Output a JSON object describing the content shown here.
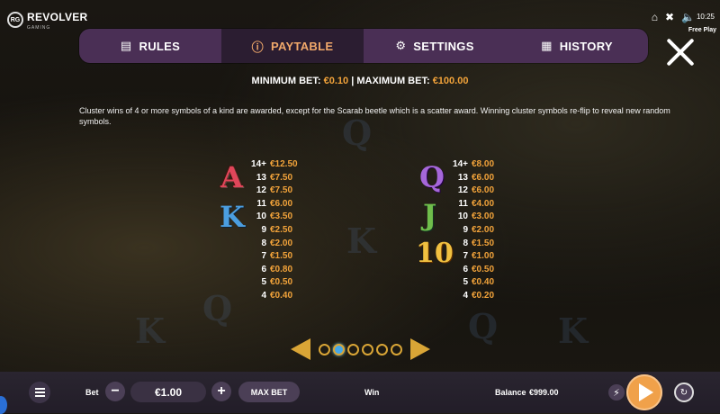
{
  "header": {
    "logo_badge": "RG",
    "logo_text": "REVOLVER",
    "logo_sub": "GAMING",
    "clock": "10:25",
    "free_play": "Free Play"
  },
  "tabs": [
    {
      "label": "RULES",
      "icon": "document-icon",
      "active": false
    },
    {
      "label": "PAYTABLE",
      "icon": "info-icon",
      "active": true
    },
    {
      "label": "SETTINGS",
      "icon": "gear-icon",
      "active": false
    },
    {
      "label": "HISTORY",
      "icon": "history-icon",
      "active": false
    }
  ],
  "bet_limits": {
    "min_label": "MINIMUM BET:",
    "min_value": "€0.10",
    "separator": "|",
    "max_label": "MAXIMUM BET:",
    "max_value": "€100.00"
  },
  "description": "Cluster wins of 4 or more symbols of a kind are awarded, except for the Scarab beetle which is a scatter award. Winning cluster symbols re-flip to reveal new random symbols.",
  "paytable": {
    "left": {
      "symbols": [
        "A",
        "K"
      ],
      "rows": [
        {
          "n": "14+",
          "v": "€12.50"
        },
        {
          "n": "13",
          "v": "€7.50"
        },
        {
          "n": "12",
          "v": "€7.50"
        },
        {
          "n": "11",
          "v": "€6.00"
        },
        {
          "n": "10",
          "v": "€3.50"
        },
        {
          "n": "9",
          "v": "€2.50"
        },
        {
          "n": "8",
          "v": "€2.00"
        },
        {
          "n": "7",
          "v": "€1.50"
        },
        {
          "n": "6",
          "v": "€0.80"
        },
        {
          "n": "5",
          "v": "€0.50"
        },
        {
          "n": "4",
          "v": "€0.40"
        }
      ]
    },
    "right": {
      "symbols": [
        "Q",
        "J",
        "10"
      ],
      "rows": [
        {
          "n": "14+",
          "v": "€8.00"
        },
        {
          "n": "13",
          "v": "€6.00"
        },
        {
          "n": "12",
          "v": "€6.00"
        },
        {
          "n": "11",
          "v": "€4.00"
        },
        {
          "n": "10",
          "v": "€3.00"
        },
        {
          "n": "9",
          "v": "€2.00"
        },
        {
          "n": "8",
          "v": "€1.50"
        },
        {
          "n": "7",
          "v": "€1.00"
        },
        {
          "n": "6",
          "v": "€0.50"
        },
        {
          "n": "5",
          "v": "€0.40"
        },
        {
          "n": "4",
          "v": "€0.20"
        }
      ]
    }
  },
  "pager": {
    "pages": 6,
    "current": 1
  },
  "bottom_bar": {
    "bet_label": "Bet",
    "bet_value": "€1.00",
    "max_bet_label": "MAX BET",
    "win_label": "Win",
    "balance_label": "Balance",
    "balance_value": "€999.00",
    "minus": "−",
    "plus": "+"
  },
  "background_ghost_letters": [
    "Q",
    "K",
    "Q",
    "K",
    "Q",
    "K"
  ]
}
